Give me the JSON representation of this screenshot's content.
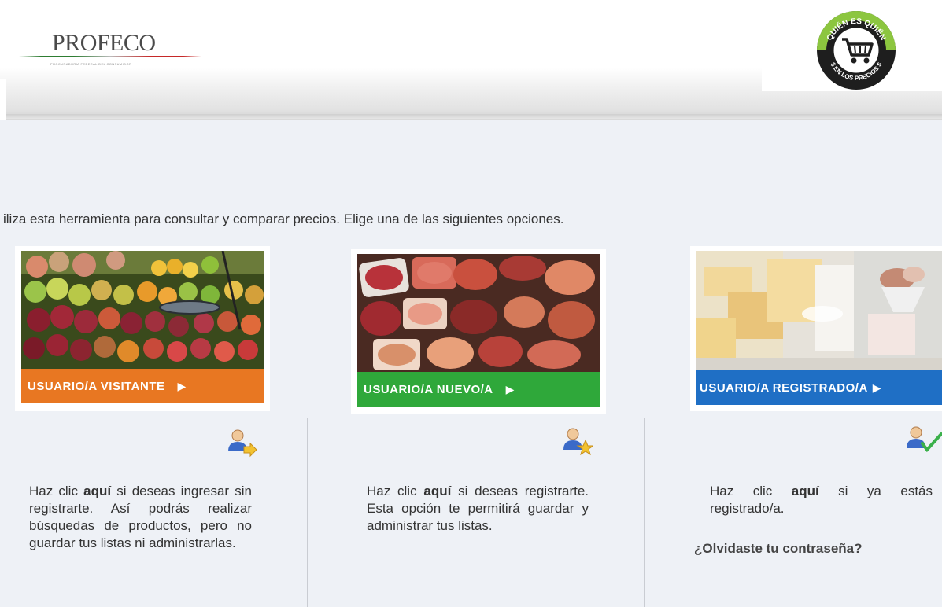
{
  "header": {
    "logo_text": "PROFECO",
    "logo_subtitle": "PROCURADURIA FEDERAL DEL CONSUMIDOR",
    "badge_top_text": "QUIÉN ES QUIÉN",
    "badge_bottom_text": "$ EN LOS PRECIOS $"
  },
  "intro_text": "iliza esta herramienta para consultar y comparar precios. Elige una de las siguientes opciones.",
  "cards": [
    {
      "label": "USUARIO/A VISITANTE",
      "color": "#e87722",
      "icon": "user-arrow-icon",
      "desc_prefix": "Haz clic ",
      "desc_link": "aquí",
      "desc_suffix": " si deseas ingresar sin registrarte. Así podrás realizar búsquedas de productos, pero no guardar tus listas ni administrarlas."
    },
    {
      "label": "USUARIO/A NUEVO/A",
      "color": "#2fa83a",
      "icon": "user-star-icon",
      "desc_prefix": "Haz clic ",
      "desc_link": "aquí",
      "desc_suffix": " si deseas registrarte. Esta opción te permitirá guardar y administrar tus listas."
    },
    {
      "label": "USUARIO/A REGISTRADO/A",
      "color": "#1f6fc5",
      "icon": "user-check-icon",
      "desc_prefix": "Haz clic ",
      "desc_link": "aquí",
      "desc_suffix": " si ya estás registrado/a."
    }
  ],
  "forgot_password": "¿Olvidaste tu contraseña?",
  "arrow_glyph": "▶"
}
